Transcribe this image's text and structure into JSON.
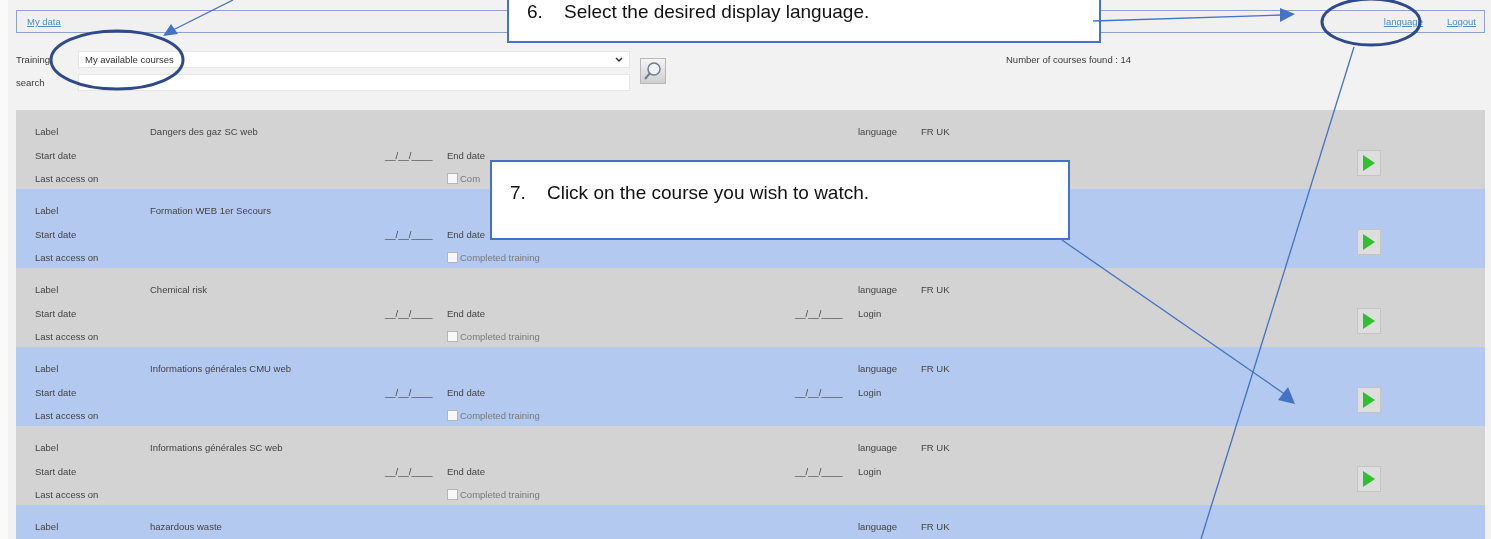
{
  "top_bar": {
    "left_links": [
      {
        "label": "My data"
      }
    ],
    "right_links": [
      {
        "label": "language"
      },
      {
        "label": "Logout"
      }
    ]
  },
  "filters": {
    "training": {
      "label": "Training",
      "value": "My available courses"
    },
    "search": {
      "label": "search"
    }
  },
  "result_count": "Number of courses found : 14",
  "courses": [
    {
      "label_caption": "Label",
      "title": "Dangers des gaz SC web",
      "start_caption": "Start date",
      "start_date": "__/__/____",
      "end_caption": "End date",
      "language_caption": "language",
      "languages": "FR UK",
      "last_access_caption": "Last access on",
      "completed": {
        "label": "Com",
        "checked": false
      },
      "play": true
    },
    {
      "label_caption": "Label",
      "title": "Formation WEB 1er Secours",
      "start_caption": "Start date",
      "start_date": "__/__/____",
      "end_caption": "End date",
      "last_access_caption": "Last access on",
      "completed": {
        "label": "Completed training",
        "checked": false
      },
      "play": true
    },
    {
      "label_caption": "Label",
      "title": "Chemical risk",
      "start_caption": "Start date",
      "start_date": "__/__/____",
      "end_caption": "End date",
      "end_date": "__/__/____",
      "language_caption": "language",
      "languages": "FR UK",
      "login_caption": "Login",
      "last_access_caption": "Last access on",
      "completed": {
        "label": "Completed training",
        "checked": false
      },
      "play": true
    },
    {
      "label_caption": "Label",
      "title": "Informations générales CMU web",
      "start_caption": "Start date",
      "start_date": "__/__/____",
      "end_caption": "End date",
      "end_date": "__/__/____",
      "language_caption": "language",
      "languages": "FR UK",
      "login_caption": "Login",
      "last_access_caption": "Last access on",
      "completed": {
        "label": "Completed training",
        "checked": false
      },
      "play": true
    },
    {
      "label_caption": "Label",
      "title": "Informations générales SC web",
      "start_caption": "Start date",
      "start_date": "__/__/____",
      "end_caption": "End date",
      "end_date": "__/__/____",
      "language_caption": "language",
      "languages": "FR UK",
      "login_caption": "Login",
      "last_access_caption": "Last access on",
      "completed": {
        "label": "Completed training",
        "checked": false
      },
      "play": true
    },
    {
      "label_caption": "Label",
      "title": "hazardous waste",
      "language_caption": "language",
      "languages": "FR UK"
    }
  ],
  "callouts": [
    {
      "text": "6.    Select the desired display language."
    },
    {
      "text": "7.    Click on the course you wish to watch."
    }
  ]
}
